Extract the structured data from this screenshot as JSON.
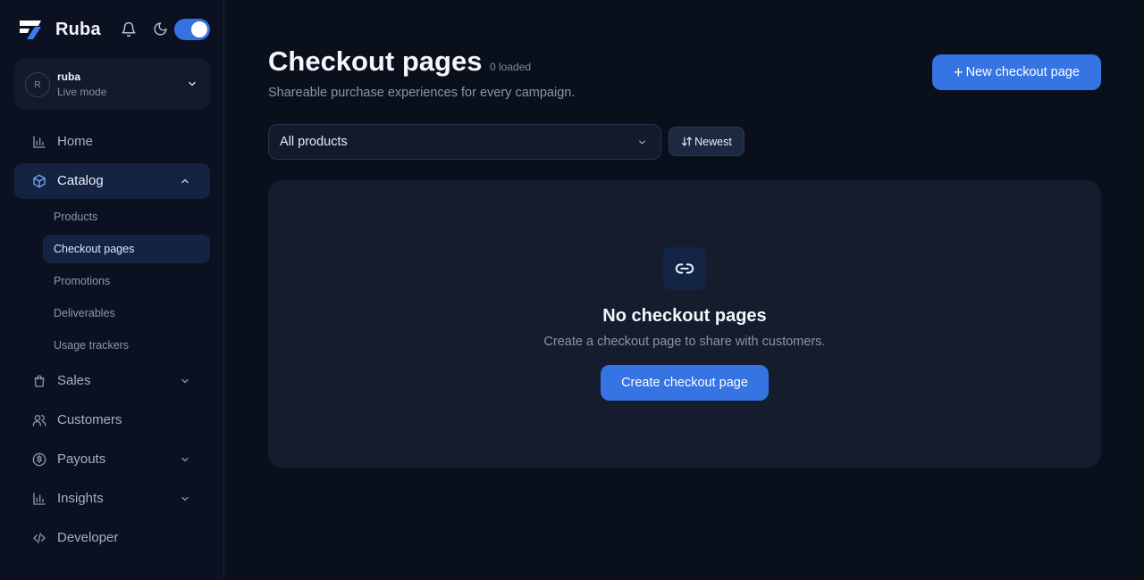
{
  "brand": {
    "name": "Ruba",
    "logo_icon": "ruba-logo",
    "accent": "#3574e2"
  },
  "header_icons": {
    "notifications": "bell-icon",
    "theme": "moon-icon",
    "theme_toggle_on": true
  },
  "account": {
    "initial": "R",
    "name": "ruba",
    "mode": "Live mode"
  },
  "nav": {
    "home": "Home",
    "catalog": "Catalog",
    "catalog_sub": {
      "products": "Products",
      "checkout_pages": "Checkout pages",
      "promotions": "Promotions",
      "deliverables": "Deliverables",
      "usage_trackers": "Usage trackers"
    },
    "sales": "Sales",
    "customers": "Customers",
    "payouts": "Payouts",
    "insights": "Insights",
    "developer": "Developer"
  },
  "page": {
    "title": "Checkout pages",
    "loaded": "0 loaded",
    "subtitle": "Shareable purchase experiences for every campaign.",
    "new_button": "New checkout page"
  },
  "filters": {
    "product_filter": "All products",
    "sort_label": "Newest"
  },
  "empty_state": {
    "icon": "link-icon",
    "title": "No checkout pages",
    "text": "Create a checkout page to share with customers.",
    "button": "Create checkout page"
  }
}
